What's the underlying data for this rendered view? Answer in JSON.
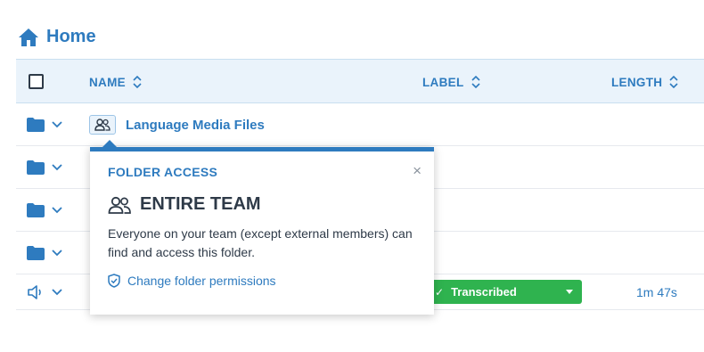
{
  "breadcrumb": {
    "home_label": "Home",
    "icon": "home-icon"
  },
  "table": {
    "columns": {
      "name": "NAME",
      "label": "LABEL",
      "length": "LENGTH"
    },
    "rows": [
      {
        "type": "folder",
        "name": "Language Media Files",
        "access": "team"
      },
      {
        "type": "folder",
        "name": ""
      },
      {
        "type": "folder",
        "name": ""
      },
      {
        "type": "folder",
        "name": ""
      },
      {
        "type": "media",
        "label": "Transcribed",
        "length": "1m 47s"
      }
    ]
  },
  "popover": {
    "heading": "FOLDER ACCESS",
    "close": "×",
    "title": "ENTIRE TEAM",
    "description": "Everyone on your team (except external members) can find and access this folder.",
    "link": "Change folder permissions"
  },
  "colors": {
    "accent": "#2e7bbf",
    "header_bg": "#eaf3fb",
    "label_green": "#2fb34f",
    "text": "#2e3a48"
  }
}
